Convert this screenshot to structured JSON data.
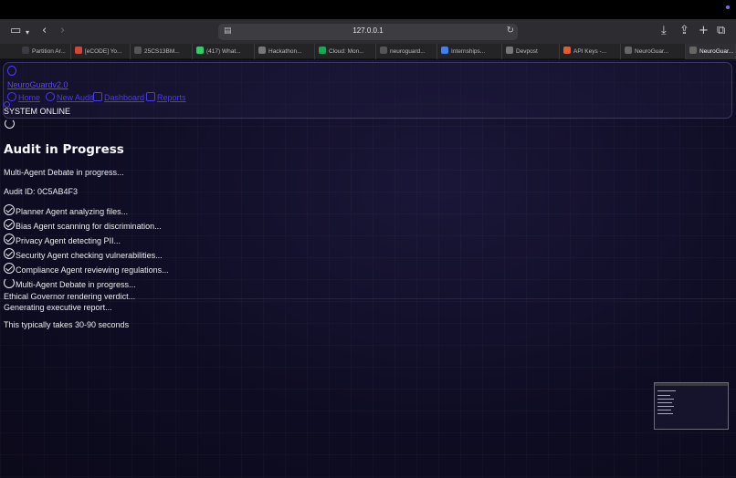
{
  "browser": {
    "url": "127.0.0.1",
    "tabs": [
      {
        "label": "Partition Ar...",
        "icon": "document-icon",
        "color": "#3b3b42"
      },
      {
        "label": "[eCODE] Yo...",
        "icon": "gmail-icon",
        "color": "#d44638"
      },
      {
        "label": "25CS13BM...",
        "icon": "github-icon",
        "color": "#555"
      },
      {
        "label": "(417) What...",
        "icon": "whatsapp-icon",
        "color": "#25d366"
      },
      {
        "label": "Hackathon...",
        "icon": "hackathon-icon",
        "color": "#777"
      },
      {
        "label": "Cloud: Mon...",
        "icon": "mongodb-icon",
        "color": "#13aa52"
      },
      {
        "label": "neuroguard...",
        "icon": "github-icon",
        "color": "#555"
      },
      {
        "label": "Internships...",
        "icon": "internshala-icon",
        "color": "#3b82f6"
      },
      {
        "label": "Devpost",
        "icon": "devpost-icon",
        "color": "#777"
      },
      {
        "label": "API Keys -...",
        "icon": "key-icon",
        "color": "#e65c2e"
      },
      {
        "label": "NeuroGuar...",
        "icon": "letter-l-icon",
        "color": "#666"
      },
      {
        "label": "NeuroGuar...",
        "icon": "letter-l-icon",
        "color": "#666"
      }
    ]
  },
  "nav": {
    "brand": "NeuroGuardv2.0",
    "links": [
      {
        "label": "Home",
        "icon": "home-icon"
      },
      {
        "label": "New Audit",
        "icon": "plus-circle-icon"
      },
      {
        "label": "Dashboard",
        "icon": "dashboard-icon"
      },
      {
        "label": "Reports",
        "icon": "reports-icon"
      }
    ],
    "status": "SYSTEM ONLINE"
  },
  "main": {
    "title": "Audit in Progress",
    "subtitle": "Multi-Agent Debate in progress...",
    "audit_id": "Audit ID: 0C5AB4F3",
    "steps": [
      {
        "label": "Planner Agent analyzing files...",
        "state": "done"
      },
      {
        "label": "Bias Agent scanning for discrimination...",
        "state": "done"
      },
      {
        "label": "Privacy Agent detecting PII...",
        "state": "done"
      },
      {
        "label": "Security Agent checking vulnerabilities...",
        "state": "done"
      },
      {
        "label": "Compliance Agent reviewing regulations...",
        "state": "done"
      },
      {
        "label": "Multi-Agent Debate in progress...",
        "state": "active"
      },
      {
        "label": "Ethical Governor rendering verdict...",
        "state": "pending"
      },
      {
        "label": "Generating executive report...",
        "state": "pending"
      }
    ],
    "note": "This typically takes 30-90 seconds"
  }
}
